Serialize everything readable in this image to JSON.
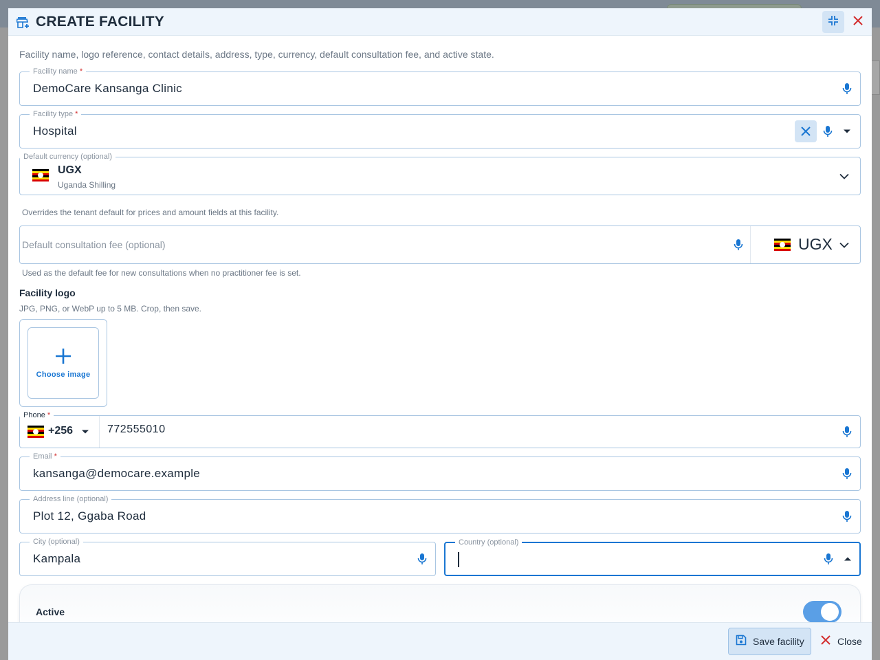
{
  "dialog": {
    "title": "CREATE FACILITY",
    "description": "Facility name, logo reference, contact details, address, type, currency, default consultation fee, and active state."
  },
  "fields": {
    "facility_name": {
      "label": "Facility name",
      "required_mark": "*",
      "value": "DemoCare Kansanga Clinic"
    },
    "facility_type": {
      "label": "Facility type",
      "required_mark": "*",
      "value": "Hospital"
    },
    "default_currency": {
      "label": "Default currency",
      "optional_tag": "(optional)",
      "code": "UGX",
      "name": "Uganda Shilling",
      "helper": "Overrides the tenant default for prices and amount fields at this facility."
    },
    "consultation_fee": {
      "placeholder": "Default consultation fee",
      "optional_tag": "(optional)",
      "currency": "UGX",
      "helper": "Used as the default fee for new consultations when no practitioner fee is set."
    },
    "logo": {
      "label": "Facility logo",
      "helper": "JPG, PNG, or WebP up to 5 MB. Crop, then save.",
      "choose_label": "Choose image"
    },
    "phone": {
      "label": "Phone",
      "required_mark": "*",
      "dial_code": "+256",
      "value": "772555010"
    },
    "email": {
      "label": "Email",
      "required_mark": "*",
      "value": "kansanga@democare.example"
    },
    "address": {
      "label": "Address line",
      "optional_tag": "(optional)",
      "value": "Plot 12, Ggaba Road"
    },
    "city": {
      "label": "City",
      "optional_tag": "(optional)",
      "value": "Kampala"
    },
    "country": {
      "label": "Country",
      "optional_tag": "(optional)",
      "value": ""
    },
    "active": {
      "label": "Active",
      "on": true
    }
  },
  "footer": {
    "save_label": "Save facility",
    "close_label": "Close"
  },
  "colors": {
    "accent": "#1976d2",
    "danger": "#d32f2f",
    "header_bg": "#eef5fc",
    "toggle_on": "#5a9fe6"
  }
}
